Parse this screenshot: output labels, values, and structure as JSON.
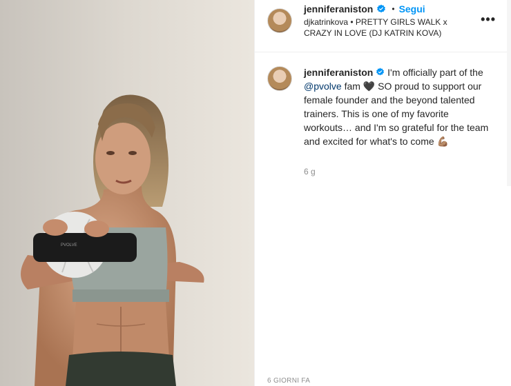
{
  "post": {
    "username": "jenniferaniston",
    "follow_label": "Segui",
    "separator": "•",
    "audio": "djkatrinkova • PRETTY GIRLS WALK x CRAZY IN LOVE (DJ KATRIN KOVA)",
    "more": "•••"
  },
  "caption": {
    "username": "jenniferaniston",
    "text_before_mention": " I'm officially part of the ",
    "mention": "@pvolve",
    "text_after_mention": " fam 🖤 SO proud to support our female founder and the beyond talented trainers. This is one of my favorite workouts… and I'm so grateful for the team and excited for what's to come 💪🏽",
    "time": "6 g"
  },
  "footer": {
    "date": "6 GIORNI FA"
  },
  "media": {
    "ring_label": "PVOLVE"
  },
  "colors": {
    "accent": "#0095f6",
    "text": "#262626",
    "muted": "#8e8e8e"
  },
  "icons": {
    "verified": "verified-badge-icon",
    "more": "more-options-icon"
  }
}
